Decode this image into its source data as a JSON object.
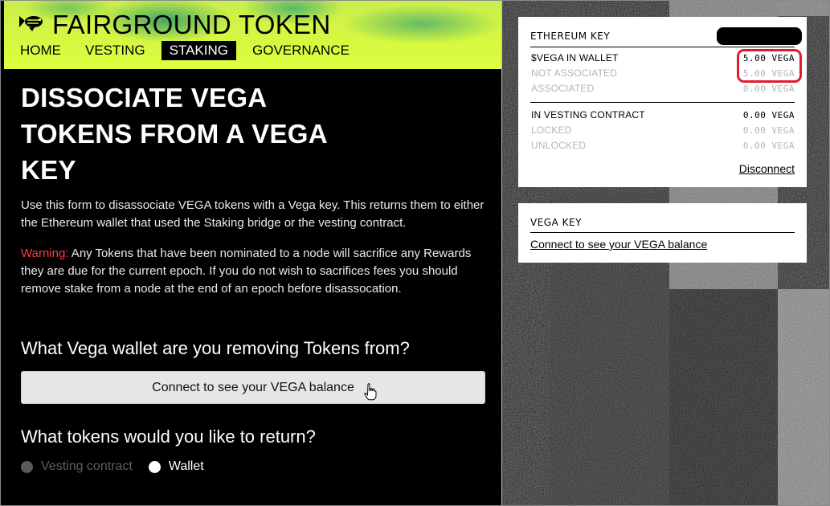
{
  "header": {
    "brand": "FAIRGROUND TOKEN",
    "nav": [
      {
        "label": "HOME",
        "active": false
      },
      {
        "label": "VESTING",
        "active": false
      },
      {
        "label": "STAKING",
        "active": true
      },
      {
        "label": "GOVERNANCE",
        "active": false
      }
    ]
  },
  "main": {
    "title": "DISSOCIATE VEGA TOKENS FROM A VEGA KEY",
    "intro": "Use this form to disassociate VEGA tokens with a Vega key. This returns them to either the Ethereum wallet that used the Staking bridge or the vesting contract.",
    "warning_label": "Warning:",
    "warning_text": " Any Tokens that have been nominated to a node will sacrifice any Rewards they are due for the current epoch. If you do not wish to sacrifices fees you should remove stake from a node at the end of an epoch before disassocation.",
    "wallet_question": "What Vega wallet are you removing Tokens from?",
    "connect_button": "Connect to see your VEGA balance",
    "tokens_question": "What tokens would you like to return?",
    "radio_vesting": "Vesting contract",
    "radio_wallet": "Wallet"
  },
  "eth_card": {
    "title": "ETHEREUM KEY",
    "rows_wallet": [
      {
        "label": "$VEGA IN WALLET",
        "value": "5.00 VEGA"
      },
      {
        "label": "NOT ASSOCIATED",
        "value": "5.00 VEGA"
      },
      {
        "label": "ASSOCIATED",
        "value": "0.00 VEGA"
      }
    ],
    "rows_vesting": [
      {
        "label": "IN VESTING CONTRACT",
        "value": "0.00 VEGA"
      },
      {
        "label": "LOCKED",
        "value": "0.00 VEGA"
      },
      {
        "label": "UNLOCKED",
        "value": "0.00 VEGA"
      }
    ],
    "disconnect": "Disconnect"
  },
  "vega_card": {
    "title": "VEGA KEY",
    "connect_link": "Connect to see your VEGA balance"
  },
  "colors": {
    "accent": "#d6f741",
    "warning": "#ff3a3a",
    "highlight": "#e21b2a"
  }
}
